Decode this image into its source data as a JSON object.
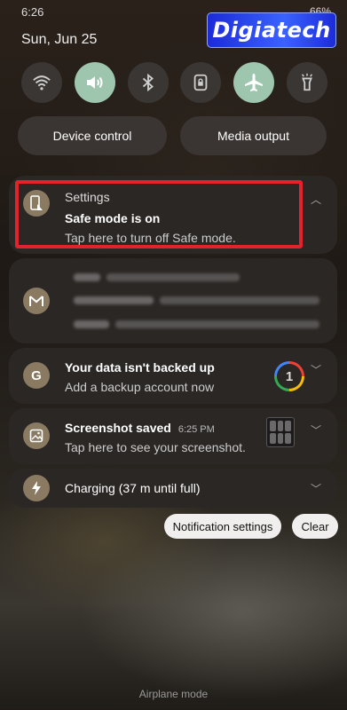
{
  "status": {
    "time": "6:26",
    "battery": "66%"
  },
  "header": {
    "date": "Sun, Jun 25"
  },
  "watermark": {
    "text": "Digiatech"
  },
  "quick_settings": [
    {
      "name": "wifi",
      "on": false,
      "glyph": "◠"
    },
    {
      "name": "sound",
      "on": true,
      "glyph": "🔊"
    },
    {
      "name": "bluetooth",
      "on": false,
      "glyph": "ᛒ"
    },
    {
      "name": "auto-rotate-lock",
      "on": false,
      "glyph": "🔒"
    },
    {
      "name": "airplane",
      "on": true,
      "glyph": "✈"
    },
    {
      "name": "flashlight",
      "on": false,
      "glyph": "🔦"
    }
  ],
  "pills": {
    "device_control": "Device control",
    "media_output": "Media output"
  },
  "notifications": {
    "settings": {
      "app": "Settings",
      "title": "Safe mode is on",
      "text": "Tap here to turn off Safe mode."
    },
    "backup": {
      "title": "Your data isn't backed up",
      "text": "Add a backup account now",
      "badge": "1"
    },
    "screenshot": {
      "title": "Screenshot saved",
      "time": "6:25 PM",
      "text": "Tap here to see your screenshot."
    },
    "charging": {
      "title": "Charging (37 m until full)"
    }
  },
  "actions": {
    "notification_settings": "Notification settings",
    "clear": "Clear"
  },
  "footer": {
    "text": "Airplane mode"
  }
}
